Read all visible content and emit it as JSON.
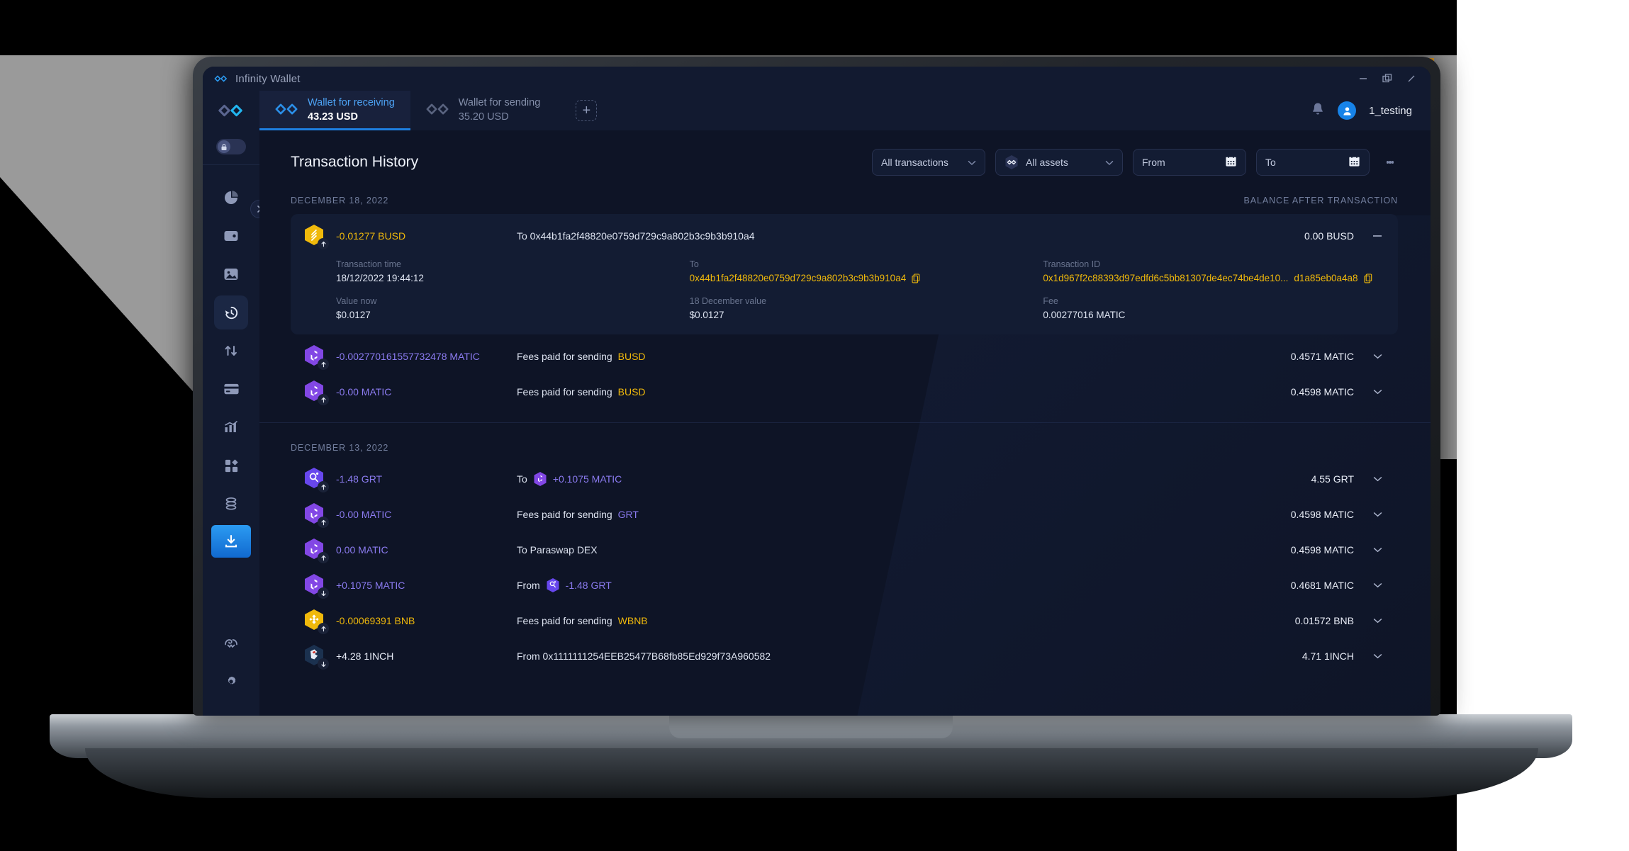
{
  "window": {
    "app_title": "Infinity Wallet",
    "minimize_label": "—",
    "maximize_label": "❐",
    "close_label": "✕"
  },
  "wallets": [
    {
      "name": "Wallet for receiving",
      "balance": "43.23 USD",
      "active": true
    },
    {
      "name": "Wallet for sending",
      "balance": "35.20 USD",
      "active": false
    }
  ],
  "add_wallet_label": "+",
  "account": {
    "username": "1_testing"
  },
  "sidebar": {
    "items": [
      {
        "icon": "pie-chart-icon",
        "active": false
      },
      {
        "icon": "wallet-icon",
        "active": false
      },
      {
        "icon": "nft-image-icon",
        "active": false
      },
      {
        "icon": "history-icon",
        "active": true
      },
      {
        "icon": "swap-arrows-icon",
        "active": false
      },
      {
        "icon": "card-icon",
        "active": false
      },
      {
        "icon": "chart-growth-icon",
        "active": false
      },
      {
        "icon": "apps-grid-icon",
        "active": false
      },
      {
        "icon": "stack-database-icon",
        "active": false
      },
      {
        "icon": "download-icon",
        "active": false
      }
    ],
    "bottom_items": [
      {
        "icon": "support-wave-icon"
      },
      {
        "icon": "gear-icon"
      }
    ]
  },
  "main": {
    "page_title": "Transaction History",
    "filters": {
      "transaction_type": "All transactions",
      "asset": "All assets",
      "from_placeholder": "From",
      "to_placeholder": "To"
    },
    "balance_column_header": "BALANCE AFTER TRANSACTION"
  },
  "sections": [
    {
      "date": "DECEMBER 18, 2022",
      "transactions": [
        {
          "expanded": true,
          "coin": "BUSD",
          "coin_color": "#f0b90b",
          "direction": "out",
          "amount": "-0.01277 BUSD",
          "amount_class": "yellow",
          "description_prefix": "To 0x44b1fa2f48820e0759d729c9a802b3c9b3b910a4",
          "balance": "0.00 BUSD",
          "detail": {
            "time_label": "Transaction time",
            "time_value": "18/12/2022 19:44:12",
            "to_label": "To",
            "to_value": "0x44b1fa2f48820e0759d729c9a802b3c9b3b910a4",
            "txid_label": "Transaction ID",
            "txid_value": "0x1d967f2c88393d97edfd6c5bb81307de4ec74be4de10...",
            "txid_suffix": "d1a85eb0a4a8",
            "value_now_label": "Value now",
            "value_now": "$0.0127",
            "dated_value_label": "18 December value",
            "dated_value": "$0.0127",
            "fee_label": "Fee",
            "fee_value": "0.00277016 MATIC"
          }
        },
        {
          "expanded": false,
          "coin": "MATIC",
          "coin_color": "#8247e5",
          "direction": "out",
          "amount": "-0.002770161557732478 MATIC",
          "amount_class": "purple",
          "desc_text": "Fees paid for sending ",
          "desc_token": "BUSD",
          "desc_token_class": "tok-yellow",
          "balance": "0.4571 MATIC"
        },
        {
          "expanded": false,
          "coin": "MATIC",
          "coin_color": "#8247e5",
          "direction": "out",
          "amount": "-0.00 MATIC",
          "amount_class": "purple",
          "desc_text": "Fees paid for sending ",
          "desc_token": "BUSD",
          "desc_token_class": "tok-yellow",
          "balance": "0.4598 MATIC"
        }
      ]
    },
    {
      "date": "DECEMBER 13, 2022",
      "transactions": [
        {
          "expanded": false,
          "coin": "GRT",
          "coin_color": "#6747ed",
          "direction": "out",
          "amount": "-1.48 GRT",
          "amount_class": "purple",
          "desc_text": "To",
          "desc_coin": "MATIC",
          "desc_coin_amount": "+0.1075 MATIC",
          "desc_token_class": "tok-purple",
          "balance": "4.55 GRT"
        },
        {
          "expanded": false,
          "coin": "MATIC",
          "coin_color": "#8247e5",
          "direction": "out",
          "amount": "-0.00 MATIC",
          "amount_class": "purple",
          "desc_text": "Fees paid for sending ",
          "desc_token": "GRT",
          "desc_token_class": "tok-purple",
          "balance": "0.4598 MATIC"
        },
        {
          "expanded": false,
          "coin": "MATIC",
          "coin_color": "#8247e5",
          "direction": "out",
          "amount": "0.00 MATIC",
          "amount_class": "purple",
          "desc_text": "To Paraswap DEX",
          "balance": "0.4598 MATIC"
        },
        {
          "expanded": false,
          "coin": "MATIC",
          "coin_color": "#8247e5",
          "direction": "in",
          "amount": "+0.1075 MATIC",
          "amount_class": "purple",
          "desc_text": "From",
          "desc_coin": "GRT",
          "desc_coin_amount": "-1.48 GRT",
          "desc_token_class": "tok-purple",
          "balance": "0.4681 MATIC"
        },
        {
          "expanded": false,
          "coin": "BNB",
          "coin_color": "#f0b90b",
          "direction": "out",
          "amount": "-0.00069391 BNB",
          "amount_class": "yellow",
          "desc_text": "Fees paid for sending ",
          "desc_token": "WBNB",
          "desc_token_class": "tok-yellow",
          "balance": "0.01572 BNB"
        },
        {
          "expanded": false,
          "coin": "1INCH",
          "coin_color": "#1b314f",
          "direction": "in",
          "amount": "+4.28 1INCH",
          "amount_class": "white",
          "desc_text": "From 0x1111111254EEB25477B68fb85Ed929f73A960582",
          "balance": "4.71 1INCH"
        }
      ]
    }
  ],
  "colors": {
    "accent_blue": "#1e7fe0",
    "binance_yellow": "#f0b90b",
    "polygon_purple": "#8247e5",
    "panel": "#131c33",
    "background": "#0e1426"
  }
}
